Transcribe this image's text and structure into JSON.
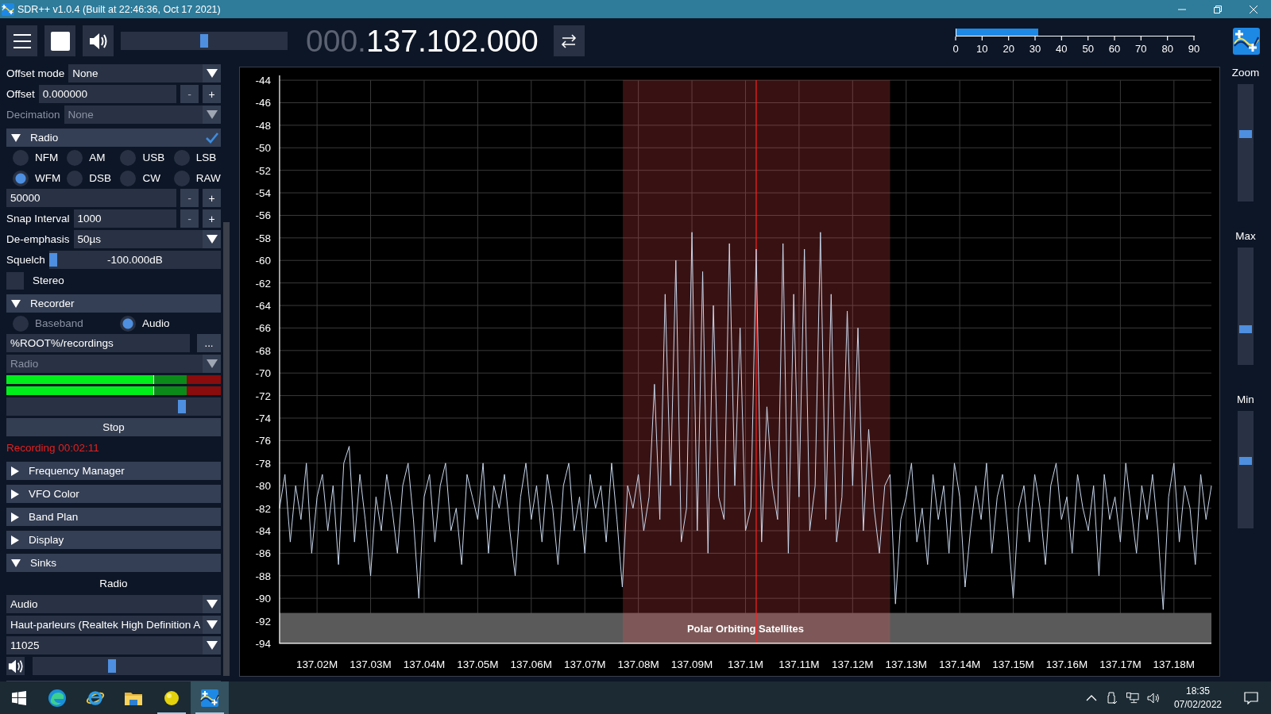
{
  "window": {
    "title": "SDR++ v1.0.4 (Built at 22:46:36, Oct 17 2021)"
  },
  "toolbar": {
    "volume": {
      "level": 0.5
    },
    "frequency": {
      "prefix": "000.",
      "value": "137.102.000"
    },
    "snr_meter": {
      "level": 0.344,
      "ticks": [
        "0",
        "10",
        "20",
        "30",
        "40",
        "50",
        "60",
        "70",
        "80",
        "90"
      ]
    }
  },
  "sidebar": {
    "rows": [
      {
        "kind": "dropdown",
        "label": "Offset mode",
        "value": "None",
        "disabled": false
      },
      {
        "kind": "number",
        "label": "Offset",
        "value": "0.000000",
        "buttons": [
          "-",
          "+"
        ]
      },
      {
        "kind": "dropdown",
        "label": "Decimation",
        "value": "None",
        "disabled": true
      },
      {
        "kind": "header",
        "label": "Radio",
        "expanded": true,
        "checked": true
      },
      {
        "kind": "radios",
        "options": [
          {
            "label": "NFM",
            "selected": false,
            "disabled": false
          },
          {
            "label": "AM",
            "selected": false,
            "disabled": false
          },
          {
            "label": "USB",
            "selected": false,
            "disabled": false
          },
          {
            "label": "LSB",
            "selected": false,
            "disabled": false
          },
          {
            "label": "WFM",
            "selected": true,
            "disabled": false
          },
          {
            "label": "DSB",
            "selected": false,
            "disabled": false
          },
          {
            "label": "CW",
            "selected": false,
            "disabled": false
          },
          {
            "label": "RAW",
            "selected": false,
            "disabled": false
          }
        ]
      },
      {
        "kind": "number",
        "value": "50000",
        "buttons": [
          "-",
          "+"
        ]
      },
      {
        "kind": "number",
        "label": "Snap Interval",
        "value": "1000",
        "buttons": [
          "-",
          "+"
        ]
      },
      {
        "kind": "dropdown",
        "label": "De-emphasis",
        "value": "50µs",
        "disabled": false
      },
      {
        "kind": "slider",
        "label": "Squelch",
        "value": "-100.000dB",
        "level": 0
      },
      {
        "kind": "checkbox",
        "label": "Stereo",
        "checked": false
      },
      {
        "kind": "header",
        "label": "Recorder",
        "expanded": true
      },
      {
        "kind": "radios",
        "options": [
          {
            "label": "Baseband",
            "selected": false,
            "disabled": true
          },
          {
            "label": "Audio",
            "selected": true,
            "disabled": false
          }
        ]
      },
      {
        "kind": "path",
        "value": "%ROOT%/recordings",
        "button": "..."
      },
      {
        "kind": "dropdown",
        "value": "Radio",
        "disabled": true
      },
      {
        "kind": "meter",
        "level": 0.69
      },
      {
        "kind": "meter",
        "level": 0.69
      },
      {
        "kind": "slider",
        "level": 0.83
      },
      {
        "kind": "button",
        "label": "Stop"
      },
      {
        "kind": "status",
        "label": "Recording 00:02:11"
      },
      {
        "kind": "header",
        "label": "Frequency Manager",
        "expanded": false
      },
      {
        "kind": "header",
        "label": "VFO Color",
        "expanded": false
      },
      {
        "kind": "header",
        "label": "Band Plan",
        "expanded": false
      },
      {
        "kind": "header",
        "label": "Display",
        "expanded": false
      },
      {
        "kind": "header",
        "label": "Sinks",
        "expanded": true
      },
      {
        "kind": "caption",
        "label": "Radio"
      },
      {
        "kind": "dropdown",
        "value": "Audio",
        "disabled": false
      },
      {
        "kind": "dropdown",
        "value": "Haut-parleurs (Realtek High Definition A",
        "disabled": false
      },
      {
        "kind": "dropdown",
        "value": "11025",
        "disabled": false
      },
      {
        "kind": "volume",
        "level": 0.42
      }
    ]
  },
  "spectrum": {
    "chart_data": {
      "type": "line",
      "grid": true,
      "xlim": [
        137.013,
        137.187
      ],
      "ylim": [
        -94,
        -44
      ],
      "bands": [
        {
          "axis": "y",
          "from": -94,
          "to": -91.3,
          "color": "#5a5a5a",
          "label": "Polar Orbiting Satellites"
        },
        {
          "axis": "x",
          "from": 137.0771,
          "to": 137.127,
          "color": "#ff5050"
        }
      ],
      "ref_lines": [
        {
          "axis": "x",
          "value": 137.102,
          "color": "#ff2020"
        }
      ],
      "yticks": [
        -44,
        -46,
        -48,
        -50,
        -52,
        -54,
        -56,
        -58,
        -60,
        -62,
        -64,
        -66,
        -68,
        -70,
        -72,
        -74,
        -76,
        -78,
        -80,
        -82,
        -84,
        -86,
        -88,
        -90,
        -92,
        -94
      ],
      "xticks": [
        {
          "value": 137.02,
          "label": "137.02M"
        },
        {
          "value": 137.03,
          "label": "137.03M"
        },
        {
          "value": 137.04,
          "label": "137.04M"
        },
        {
          "value": 137.05,
          "label": "137.05M"
        },
        {
          "value": 137.06,
          "label": "137.06M"
        },
        {
          "value": 137.07,
          "label": "137.07M"
        },
        {
          "value": 137.08,
          "label": "137.08M"
        },
        {
          "value": 137.09,
          "label": "137.09M"
        },
        {
          "value": 137.1,
          "label": "137.1M"
        },
        {
          "value": 137.11,
          "label": "137.11M"
        },
        {
          "value": 137.12,
          "label": "137.12M"
        },
        {
          "value": 137.13,
          "label": "137.13M"
        },
        {
          "value": 137.14,
          "label": "137.14M"
        },
        {
          "value": 137.15,
          "label": "137.15M"
        },
        {
          "value": 137.16,
          "label": "137.16M"
        },
        {
          "value": 137.17,
          "label": "137.17M"
        },
        {
          "value": 137.18,
          "label": "137.18M"
        }
      ],
      "x": [
        137.013,
        137.014,
        137.015,
        137.016,
        137.017,
        137.018,
        137.019,
        137.02,
        137.021,
        137.022,
        137.023,
        137.024,
        137.025,
        137.026,
        137.027,
        137.028,
        137.029,
        137.03,
        137.031,
        137.032,
        137.033,
        137.034,
        137.035,
        137.036,
        137.037,
        137.038,
        137.039,
        137.04,
        137.041,
        137.042,
        137.043,
        137.044,
        137.045,
        137.046,
        137.047,
        137.048,
        137.049,
        137.05,
        137.051,
        137.052,
        137.053,
        137.054,
        137.055,
        137.056,
        137.057,
        137.058,
        137.059,
        137.06,
        137.061,
        137.062,
        137.063,
        137.064,
        137.065,
        137.066,
        137.067,
        137.068,
        137.069,
        137.07,
        137.071,
        137.072,
        137.073,
        137.074,
        137.075,
        137.076,
        137.077,
        137.078,
        137.079,
        137.08,
        137.081,
        137.082,
        137.083,
        137.084,
        137.085,
        137.086,
        137.087,
        137.088,
        137.089,
        137.09,
        137.091,
        137.092,
        137.093,
        137.094,
        137.095,
        137.096,
        137.097,
        137.098,
        137.099,
        137.1,
        137.101,
        137.102,
        137.103,
        137.104,
        137.105,
        137.106,
        137.107,
        137.108,
        137.109,
        137.11,
        137.111,
        137.112,
        137.113,
        137.114,
        137.115,
        137.116,
        137.117,
        137.118,
        137.119,
        137.12,
        137.121,
        137.122,
        137.123,
        137.124,
        137.125,
        137.126,
        137.127,
        137.128,
        137.129,
        137.13,
        137.131,
        137.132,
        137.133,
        137.134,
        137.135,
        137.136,
        137.137,
        137.138,
        137.139,
        137.14,
        137.141,
        137.142,
        137.143,
        137.144,
        137.145,
        137.146,
        137.147,
        137.148,
        137.149,
        137.15,
        137.151,
        137.152,
        137.153,
        137.154,
        137.155,
        137.156,
        137.157,
        137.158,
        137.159,
        137.16,
        137.161,
        137.162,
        137.163,
        137.164,
        137.165,
        137.166,
        137.167,
        137.168,
        137.169,
        137.17,
        137.171,
        137.172,
        137.173,
        137.174,
        137.175,
        137.176,
        137.177,
        137.178,
        137.179,
        137.18,
        137.181,
        137.182,
        137.183,
        137.184,
        137.185,
        137.186,
        137.187
      ],
      "values": [
        -82,
        -79,
        -85,
        -80,
        -83,
        -78,
        -86,
        -81,
        -79,
        -84,
        -80,
        -87,
        -78,
        -76.5,
        -85,
        -79,
        -83,
        -88,
        -81,
        -84,
        -79,
        -82,
        -86,
        -80,
        -78,
        -83,
        -90,
        -81,
        -79,
        -85,
        -80,
        -78,
        -84,
        -82,
        -87,
        -79,
        -81,
        -83,
        -78,
        -86,
        -80,
        -82,
        -79,
        -84,
        -88,
        -81,
        -78,
        -83,
        -80,
        -85,
        -79,
        -82,
        -87,
        -80,
        -78,
        -84,
        -81,
        -86,
        -79,
        -82,
        -80,
        -85,
        -78,
        -83,
        -89,
        -80,
        -82,
        -79,
        -84,
        -81,
        -71,
        -83,
        -63,
        -80,
        -60,
        -85,
        -82,
        -57.5,
        -84,
        -61,
        -86,
        -64,
        -81,
        -83,
        -58.5,
        -80,
        -66,
        -84,
        -82,
        -59,
        -85,
        -73,
        -80,
        -83,
        -58.5,
        -86,
        -63,
        -81,
        -59,
        -84,
        -80,
        -57.5,
        -83,
        -63,
        -85,
        -81,
        -64.5,
        -80,
        -66,
        -84,
        -75,
        -82,
        -86,
        -80,
        -79,
        -90.5,
        -83,
        -81,
        -78,
        -85,
        -82,
        -87,
        -79,
        -83,
        -80,
        -86,
        -78,
        -81,
        -89,
        -84,
        -80,
        -83,
        -78,
        -86,
        -81,
        -79,
        -84,
        -90,
        -82,
        -80,
        -85,
        -79,
        -82,
        -87,
        -80,
        -78,
        -83,
        -81,
        -86,
        -79,
        -82,
        -84,
        -80,
        -88,
        -79,
        -83,
        -81,
        -85,
        -78,
        -82,
        -86,
        -80,
        -83,
        -79,
        -84,
        -91,
        -81,
        -78,
        -85,
        -80,
        -82,
        -87,
        -79,
        -83,
        -80
      ]
    }
  },
  "side_sliders": [
    {
      "label": "Zoom",
      "level": 0.58
    },
    {
      "label": "Max",
      "level": 0.29
    },
    {
      "label": "Min",
      "level": 0.58
    }
  ],
  "taskbar": {
    "apps": [
      {
        "running": false,
        "selected": false
      },
      {
        "running": false,
        "selected": false
      },
      {
        "running": false,
        "selected": false
      },
      {
        "running": true,
        "selected": false
      },
      {
        "running": true,
        "selected": true
      }
    ],
    "clock": {
      "time": "18:35",
      "date": "07/02/2022"
    }
  }
}
